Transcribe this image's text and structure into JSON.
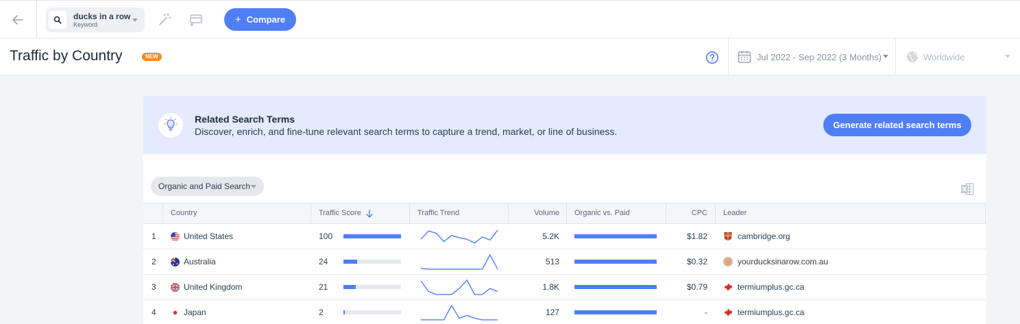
{
  "keyword": {
    "term": "ducks in a row",
    "type": "Keyword"
  },
  "toolbar": {
    "compare_label": "Compare"
  },
  "header": {
    "title": "Traffic by Country",
    "badge": "NEW",
    "date_range": "Jul 2022 - Sep 2022 (3 Months)",
    "region": "Worldwide"
  },
  "banner": {
    "title": "Related Search Terms",
    "description": "Discover, enrich, and fine-tune relevant search terms to capture a trend, market, or line of business.",
    "button_label": "Generate related search terms"
  },
  "filter": {
    "label": "Organic and Paid Search"
  },
  "table": {
    "columns": {
      "country": "Country",
      "traffic_score": "Traffic Score",
      "traffic_trend": "Traffic Trend",
      "volume": "Volume",
      "organic_vs_paid": "Organic vs. Paid",
      "cpc": "CPC",
      "leader": "Leader"
    },
    "rows": [
      {
        "rank": "1",
        "country": "United States",
        "flag": "us-flag",
        "score": "100",
        "score_pct": 1.0,
        "trend": [
          0.35,
          0.9,
          0.75,
          0.2,
          0.6,
          0.45,
          0.35,
          0.1,
          0.5,
          0.3,
          0.95
        ],
        "volume": "5.2K",
        "organic_pct": 1.0,
        "cpc": "$1.82",
        "leader": "cambridge.org",
        "leader_icon": "shield-crest-icon"
      },
      {
        "rank": "2",
        "country": "Australia",
        "flag": "au-flag",
        "score": "24",
        "score_pct": 0.24,
        "trend": [
          0.1,
          0.05,
          0.05,
          0.05,
          0.05,
          0.05,
          0.05,
          0.05,
          0.05,
          1.0,
          0.05
        ],
        "volume": "513",
        "organic_pct": 1.0,
        "cpc": "$0.32",
        "leader": "yourducksinarow.com.au",
        "leader_icon": "site-avatar-icon"
      },
      {
        "rank": "3",
        "country": "United Kingdom",
        "flag": "uk-flag",
        "score": "21",
        "score_pct": 0.21,
        "trend": [
          0.95,
          0.25,
          0.05,
          0.05,
          0.05,
          0.45,
          1.0,
          0.05,
          0.05,
          0.45,
          0.25
        ],
        "volume": "1.8K",
        "organic_pct": 1.0,
        "cpc": "$0.79",
        "leader": "termiumplus.gc.ca",
        "leader_icon": "maple-leaf-icon"
      },
      {
        "rank": "4",
        "country": "Japan",
        "flag": "jp-flag",
        "score": "2",
        "score_pct": 0.02,
        "trend": [
          0.05,
          0.05,
          0.05,
          0.05,
          1.0,
          0.15,
          0.35,
          0.15,
          0.05,
          0.05,
          0.05
        ],
        "volume": "127",
        "organic_pct": 1.0,
        "cpc": "-",
        "leader": "termiumplus.gc.ca",
        "leader_icon": "maple-leaf-icon"
      }
    ]
  },
  "colors": {
    "accent": "#4f7ef5",
    "badge": "#f28a27",
    "banner_bg": "#e3ebfc"
  }
}
